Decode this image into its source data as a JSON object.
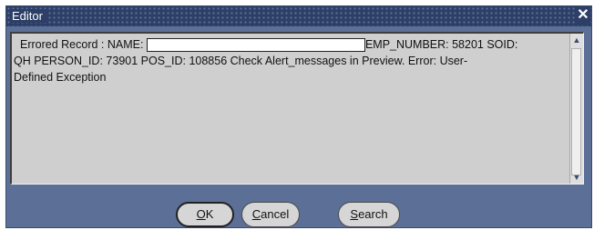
{
  "window": {
    "title": "Editor",
    "close_glyph": "✕"
  },
  "message": {
    "line1_prefix": "Errored Record : NAME:",
    "line1_suffix": "EMP_NUMBER: 58201 SOID:",
    "line2": "QH PERSON_ID: 73901 POS_ID: 108856 Check Alert_messages in Preview. Error: User-",
    "line3": "Defined Exception",
    "name_value": ""
  },
  "buttons": {
    "ok": {
      "mnemonic": "O",
      "rest": "K"
    },
    "cancel": {
      "mnemonic": "C",
      "rest": "ancel"
    },
    "search": {
      "mnemonic": "S",
      "rest": "earch"
    }
  },
  "scrollbar": {
    "up_glyph": "▲",
    "down_glyph": "▼"
  }
}
